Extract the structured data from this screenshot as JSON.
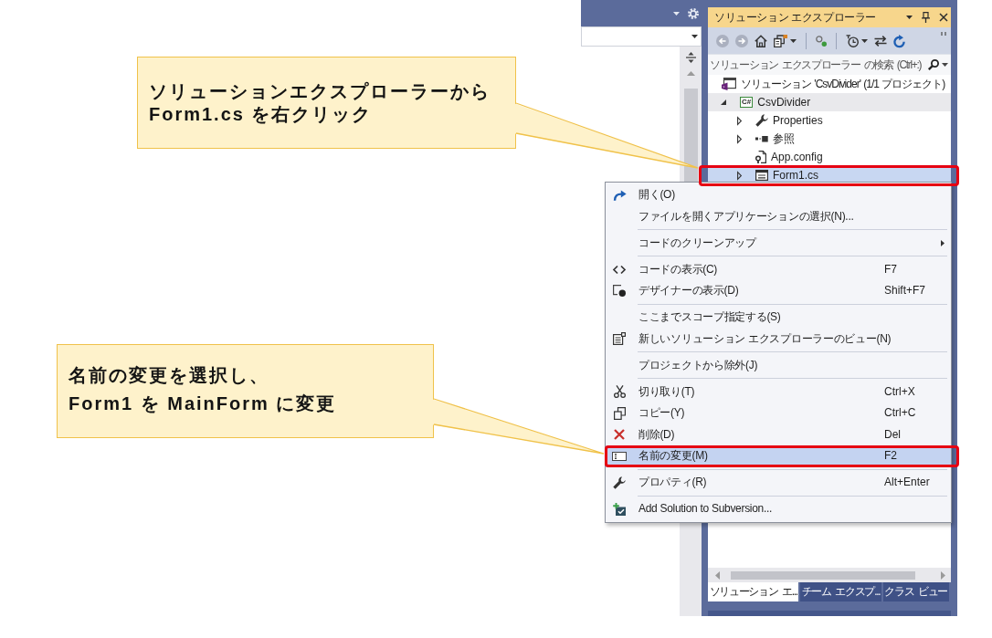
{
  "callouts": [
    {
      "text": "ソリューションエクスプローラーから\nForm1.cs を右クリック"
    },
    {
      "text": "名前の変更を選択し、\nForm1 を MainForm に変更"
    }
  ],
  "solution_explorer": {
    "title": "ソリューション エクスプローラー",
    "toolbar": [
      {
        "kind": "button",
        "disabled": true
      },
      {
        "kind": "button",
        "disabled": true
      },
      {
        "kind": "button",
        "disabled": false
      },
      {
        "kind": "dropdown",
        "disabled": false
      },
      {
        "kind": "separator"
      },
      {
        "kind": "button",
        "disabled": false
      },
      {
        "kind": "separator"
      },
      {
        "kind": "dropdown",
        "disabled": false
      },
      {
        "kind": "button",
        "disabled": false
      },
      {
        "kind": "button",
        "disabled": false
      }
    ],
    "search": {
      "placeholder": "ソリューション エクスプローラー の検索 (Ctrl+:)"
    },
    "tree": [
      {
        "kind": "solution",
        "label": "ソリューション 'CsvDivider' (1/1 プロジェクト)",
        "selected": false,
        "shaded": false,
        "outlined": false,
        "children": [
          {
            "kind": "project",
            "badge": "C#",
            "label": "CsvDivider",
            "expanded": true,
            "selected": false,
            "shaded": true,
            "outlined": false,
            "children": [
              {
                "kind": "properties",
                "label": "Properties",
                "expanded": false,
                "selected": false,
                "shaded": false,
                "outlined": false
              },
              {
                "kind": "references",
                "label": "参照",
                "expanded": false,
                "selected": false,
                "shaded": false,
                "outlined": false
              },
              {
                "kind": "config",
                "label": "App.config",
                "selected": false,
                "shaded": false,
                "outlined": false
              },
              {
                "kind": "form",
                "label": "Form1.cs",
                "expanded": false,
                "selected": true,
                "shaded": false,
                "outlined": true
              }
            ]
          }
        ]
      }
    ],
    "tabs": [
      {
        "label": "ソリューション エ...",
        "selected": true
      },
      {
        "label": "チーム エクスプ...",
        "selected": false
      },
      {
        "label": "クラス ビュー",
        "selected": false
      }
    ]
  },
  "context_menu": {
    "items": [
      {
        "kind": "command",
        "label": "開く(O)",
        "selected": false,
        "submenu": false,
        "outlined": false
      },
      {
        "kind": "command",
        "label": "ファイルを開くアプリケーションの選択(N)...",
        "selected": false,
        "submenu": false,
        "outlined": false
      },
      {
        "kind": "separator"
      },
      {
        "kind": "command",
        "label": "コードのクリーンアップ",
        "selected": false,
        "submenu": true,
        "outlined": false
      },
      {
        "kind": "separator"
      },
      {
        "kind": "command",
        "label": "コードの表示(C)",
        "shortcut": "F7",
        "selected": false,
        "submenu": false,
        "outlined": false
      },
      {
        "kind": "command",
        "label": "デザイナーの表示(D)",
        "shortcut": "Shift+F7",
        "selected": false,
        "submenu": false,
        "outlined": false
      },
      {
        "kind": "separator"
      },
      {
        "kind": "command",
        "label": "ここまでスコープ指定する(S)",
        "selected": false,
        "submenu": false,
        "outlined": false
      },
      {
        "kind": "command",
        "label": "新しいソリューション エクスプローラーのビュー(N)",
        "selected": false,
        "submenu": false,
        "outlined": false
      },
      {
        "kind": "separator"
      },
      {
        "kind": "command",
        "label": "プロジェクトから除外(J)",
        "selected": false,
        "submenu": false,
        "outlined": false
      },
      {
        "kind": "separator"
      },
      {
        "kind": "command",
        "label": "切り取り(T)",
        "shortcut": "Ctrl+X",
        "selected": false,
        "submenu": false,
        "outlined": false
      },
      {
        "kind": "command",
        "label": "コピー(Y)",
        "shortcut": "Ctrl+C",
        "selected": false,
        "submenu": false,
        "outlined": false
      },
      {
        "kind": "command",
        "label": "削除(D)",
        "shortcut": "Del",
        "selected": false,
        "submenu": false,
        "outlined": false
      },
      {
        "kind": "command",
        "label": "名前の変更(M)",
        "shortcut": "F2",
        "selected": true,
        "submenu": false,
        "outlined": true
      },
      {
        "kind": "separator"
      },
      {
        "kind": "command",
        "label": "プロパティ(R)",
        "shortcut": "Alt+Enter",
        "selected": false,
        "submenu": false,
        "outlined": false
      },
      {
        "kind": "separator"
      },
      {
        "kind": "command",
        "label": "Add Solution to Subversion...",
        "selected": false,
        "submenu": false,
        "outlined": false
      }
    ]
  }
}
